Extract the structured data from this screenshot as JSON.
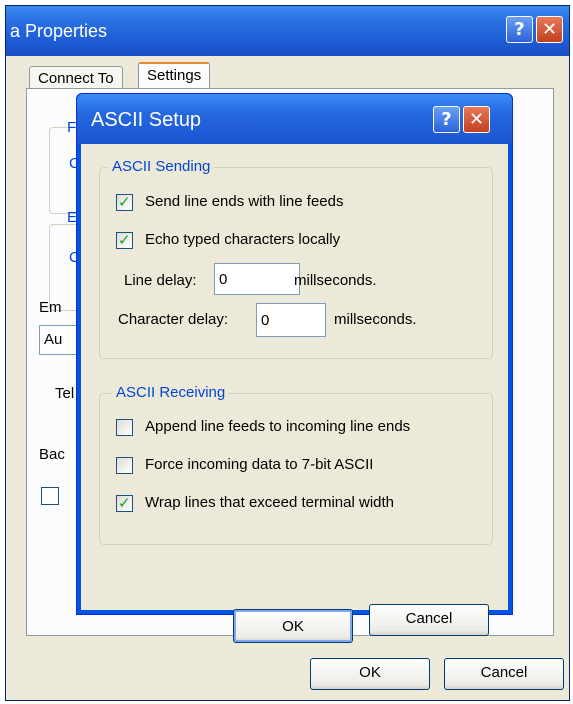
{
  "outer_window": {
    "title": "a Properties",
    "tabs": [
      {
        "label": "Connect To",
        "selected": false
      },
      {
        "label": "Settings",
        "selected": true
      }
    ],
    "partial_labels": [
      "F",
      "C",
      "E",
      "C",
      "Em",
      "Au",
      "Tel",
      "Bac"
    ],
    "ok_label": "OK",
    "cancel_label": "Cancel"
  },
  "dialog": {
    "title": "ASCII Setup",
    "help_glyph": "?",
    "close_glyph": "✕",
    "sending": {
      "legend": "ASCII Sending",
      "checkboxes": [
        {
          "label": "Send line ends with line feeds",
          "checked": true
        },
        {
          "label": "Echo typed characters locally",
          "checked": true
        }
      ],
      "line_delay": {
        "label": "Line delay:",
        "value": "0",
        "unit": "millseconds."
      },
      "char_delay": {
        "label": "Character delay:",
        "value": "0",
        "unit": "millseconds."
      }
    },
    "receiving": {
      "legend": "ASCII Receiving",
      "checkboxes": [
        {
          "label": "Append line feeds to incoming line ends",
          "checked": false
        },
        {
          "label": "Force incoming data to 7-bit ASCII",
          "checked": false
        },
        {
          "label": "Wrap lines that exceed terminal width",
          "checked": true
        }
      ]
    },
    "ok_label": "OK",
    "cancel_label": "Cancel"
  },
  "check_glyph": "✓",
  "colors": {
    "titlebar": "#2467e0",
    "dialog_face": "#ece9d8",
    "group_legend": "#0046d5",
    "check": "#21a121",
    "close_button": "#c2401f"
  }
}
